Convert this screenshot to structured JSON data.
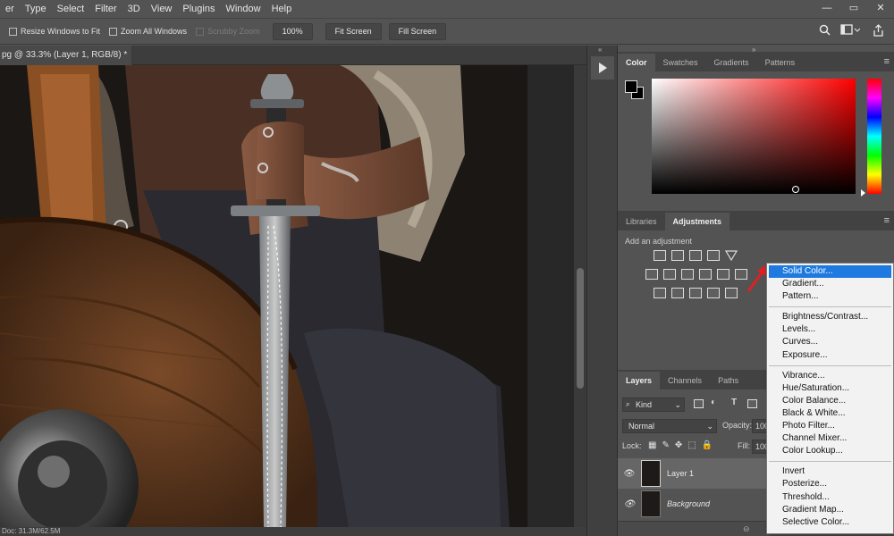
{
  "menubar": {
    "items": [
      "er",
      "Type",
      "Select",
      "Filter",
      "3D",
      "View",
      "Plugins",
      "Window",
      "Help"
    ],
    "min": "—",
    "max": "▭",
    "close": "✕"
  },
  "options": {
    "resize_windows": "Resize Windows to Fit",
    "zoom_all": "Zoom All Windows",
    "scrubby": "Scrubby Zoom",
    "zoom_value": "100%",
    "fit_screen": "Fit Screen",
    "fill_screen": "Fill Screen"
  },
  "document": {
    "tab_title": "pg @ 33.3% (Layer 1, RGB/8) *",
    "close": "×",
    "status": "Doc: 31.3M/62.5M"
  },
  "color_panel": {
    "tabs": [
      "Color",
      "Swatches",
      "Gradients",
      "Patterns"
    ],
    "hue": "#ff0000"
  },
  "adjust_panel": {
    "tabs": [
      "Libraries",
      "Adjustments"
    ],
    "add_label": "Add an adjustment"
  },
  "layers_panel": {
    "tabs": [
      "Layers",
      "Channels",
      "Paths"
    ],
    "kind": "Kind",
    "blend": "Normal",
    "opacity_label": "Opacity:",
    "opacity_value": "100",
    "lock_label": "Lock:",
    "fill_label": "Fill:",
    "fill_value": "100",
    "layers": [
      "Layer 1",
      "Background"
    ]
  },
  "dropdown": {
    "group1": [
      "Solid Color...",
      "Gradient...",
      "Pattern..."
    ],
    "group2": [
      "Brightness/Contrast...",
      "Levels...",
      "Curves...",
      "Exposure..."
    ],
    "group3": [
      "Vibrance...",
      "Hue/Saturation...",
      "Color Balance...",
      "Black & White...",
      "Photo Filter...",
      "Channel Mixer...",
      "Color Lookup..."
    ],
    "group4": [
      "Invert",
      "Posterize...",
      "Threshold...",
      "Gradient Map...",
      "Selective Color..."
    ]
  },
  "accent": "#1e7ae0"
}
